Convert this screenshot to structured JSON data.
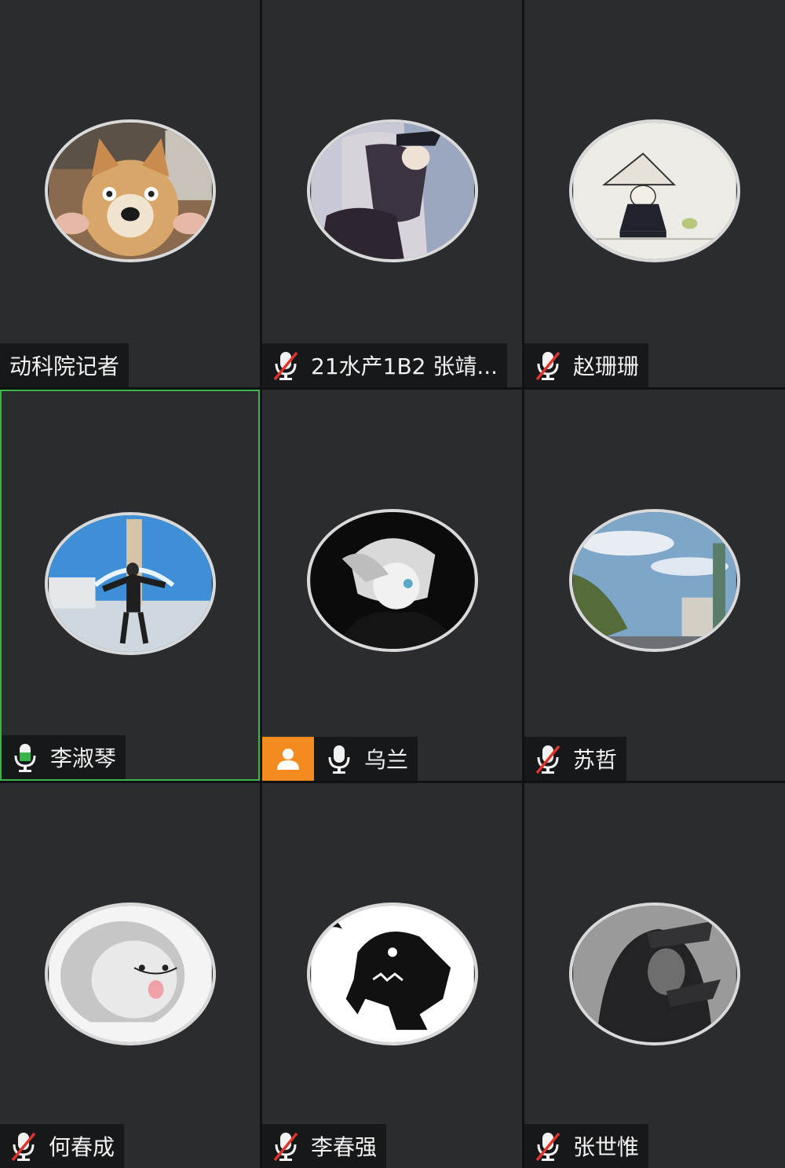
{
  "participants": [
    {
      "name": "动科院记者",
      "mic": "none",
      "avatar": "dog-bread"
    },
    {
      "name": "21水产1B2 张靖...",
      "mic": "muted",
      "avatar": "anime-couple"
    },
    {
      "name": "赵珊珊",
      "mic": "muted",
      "avatar": "monk-frog"
    },
    {
      "name": "李淑琴",
      "mic": "speaking",
      "avatar": "fountain-person"
    },
    {
      "name": "乌兰",
      "mic": "on",
      "host": true,
      "avatar": "anime-dark"
    },
    {
      "name": "苏哲",
      "mic": "muted",
      "avatar": "sky-city"
    },
    {
      "name": "何春成",
      "mic": "muted",
      "avatar": "seal-meme"
    },
    {
      "name": "李春强",
      "mic": "muted",
      "avatar": "dino-silhouette"
    },
    {
      "name": "张世惟",
      "mic": "muted",
      "avatar": "hooded-person"
    }
  ],
  "colors": {
    "tile_bg": "#2a2c2f",
    "grid_gap": "#111214",
    "speaking_border": "#39b54a",
    "muted_slash": "#e0342b",
    "host_badge": "#f38b1e"
  }
}
